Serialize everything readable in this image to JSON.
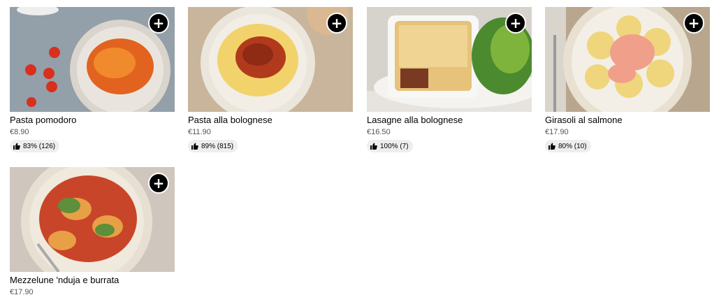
{
  "add_button_symbol": "+",
  "items": [
    {
      "name": "Pasta pomodoro",
      "price": "€8.90",
      "rating": "83% (126)",
      "icon": "thumbs-up-icon"
    },
    {
      "name": "Pasta alla bolognese",
      "price": "€11.90",
      "rating": "89% (815)",
      "icon": "thumbs-up-icon"
    },
    {
      "name": "Lasagne alla bolognese",
      "price": "€16.50",
      "rating": "100% (7)",
      "icon": "thumbs-up-icon"
    },
    {
      "name": "Girasoli al salmone",
      "price": "€17.90",
      "rating": "80% (10)",
      "icon": "thumbs-up-icon"
    },
    {
      "name": "Mezzelune 'nduja e burrata",
      "price": "€17.90",
      "rating": "",
      "icon": "thumbs-up-icon"
    }
  ],
  "colors": {
    "price_text": "#545454",
    "rating_bg": "#eeeeee",
    "add_button_bg": "#000000"
  }
}
